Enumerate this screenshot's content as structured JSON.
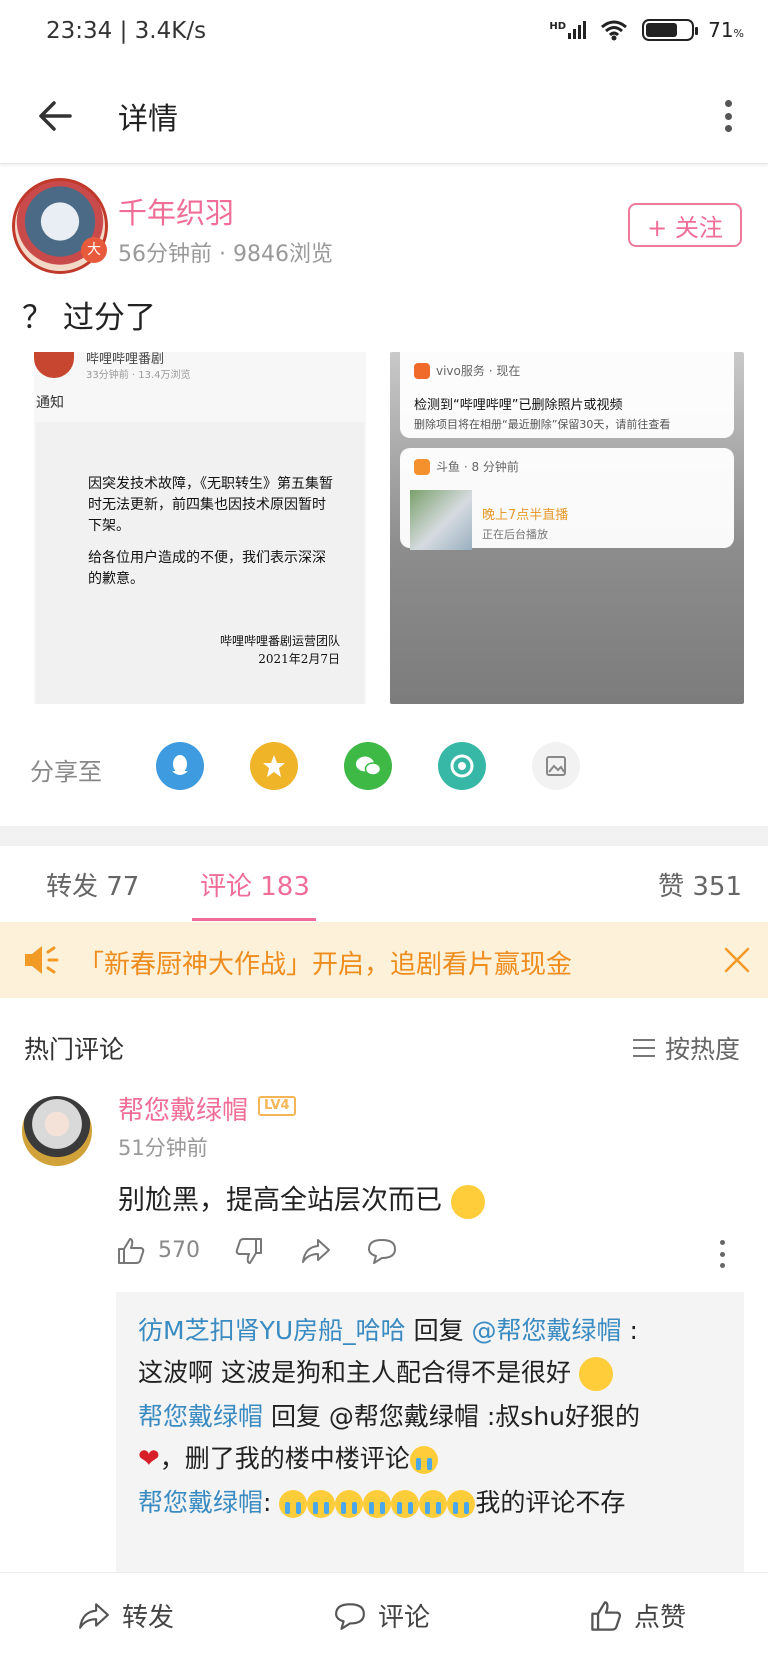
{
  "status_bar": {
    "time": "23:34 | 3.4K/s",
    "network": "HD",
    "battery_level": 71,
    "battery_label": "71"
  },
  "toolbar": {
    "title": "详情"
  },
  "post": {
    "author": "千年织羽",
    "meta": "56分钟前 · 9846浏览",
    "follow_label": "+ 关注",
    "text": "？ 过分了"
  },
  "image1": {
    "account": "哔哩哔哩番剧",
    "meta": "33分钟前 · 13.4万浏览",
    "label": "通知",
    "para1": "因突发技术故障，《无职转生》第五集暂时无法更新，前四集也因技术原因暂时下架。",
    "para2": "给各位用户造成的不便，我们表示深深的歉意。",
    "sign_team": "哔哩哔哩番剧运营团队",
    "sign_date": "2021年2月7日"
  },
  "image2": {
    "card1": {
      "header": "vivo服务 · 现在",
      "title": "检测到“哔哩哔哩”已删除照片或视频",
      "body": "删除项目将在相册“最近删除”保留30天，请前往查看"
    },
    "card2": {
      "header": "斗鱼 · 8 分钟前",
      "title": "晚上7点半直播",
      "body": "正在后台播放"
    }
  },
  "share": {
    "label": "分享至",
    "targets": [
      {
        "icon": "qq-icon",
        "color": "#3e9be0"
      },
      {
        "icon": "qzone-icon",
        "color": "#f0b429"
      },
      {
        "icon": "wechat-icon",
        "color": "#3fb945"
      },
      {
        "icon": "moments-icon",
        "color": "#37b8a6"
      },
      {
        "icon": "save-image-icon",
        "color": "#f2f2f2"
      }
    ]
  },
  "tabs": {
    "repost": "转发 77",
    "comments": "评论 183",
    "likes": "赞 351"
  },
  "banner": {
    "text": "「新春厨神大作战」开启，追剧看片赢现金"
  },
  "hot_comments": {
    "title": "热门评论",
    "sort_label": "按热度"
  },
  "comment": {
    "author": "帮您戴绿帽",
    "level": "LV4",
    "time": "51分钟前",
    "text": "别尬黑，提高全站层次而已",
    "like_count": "570"
  },
  "replies": [
    {
      "author": "彷M芝扣肾YU房船_哈哈",
      "verb": " 回复 ",
      "target": "@帮您戴绿帽",
      "sep": " :",
      "text": "这波啊 这波是狗和主人配合得不是很好"
    },
    {
      "author": "帮您戴绿帽",
      "verb": " 回复 ",
      "target_plain": "@帮您戴绿帽 :叔shu好狠的",
      "text2": "，删了我的楼中楼评论"
    },
    {
      "author": "帮您戴绿帽",
      "sep": ": ",
      "text": "我的评论不存"
    }
  ],
  "bottom_bar": {
    "repost": "转发",
    "comment": "评论",
    "like": "点赞"
  }
}
